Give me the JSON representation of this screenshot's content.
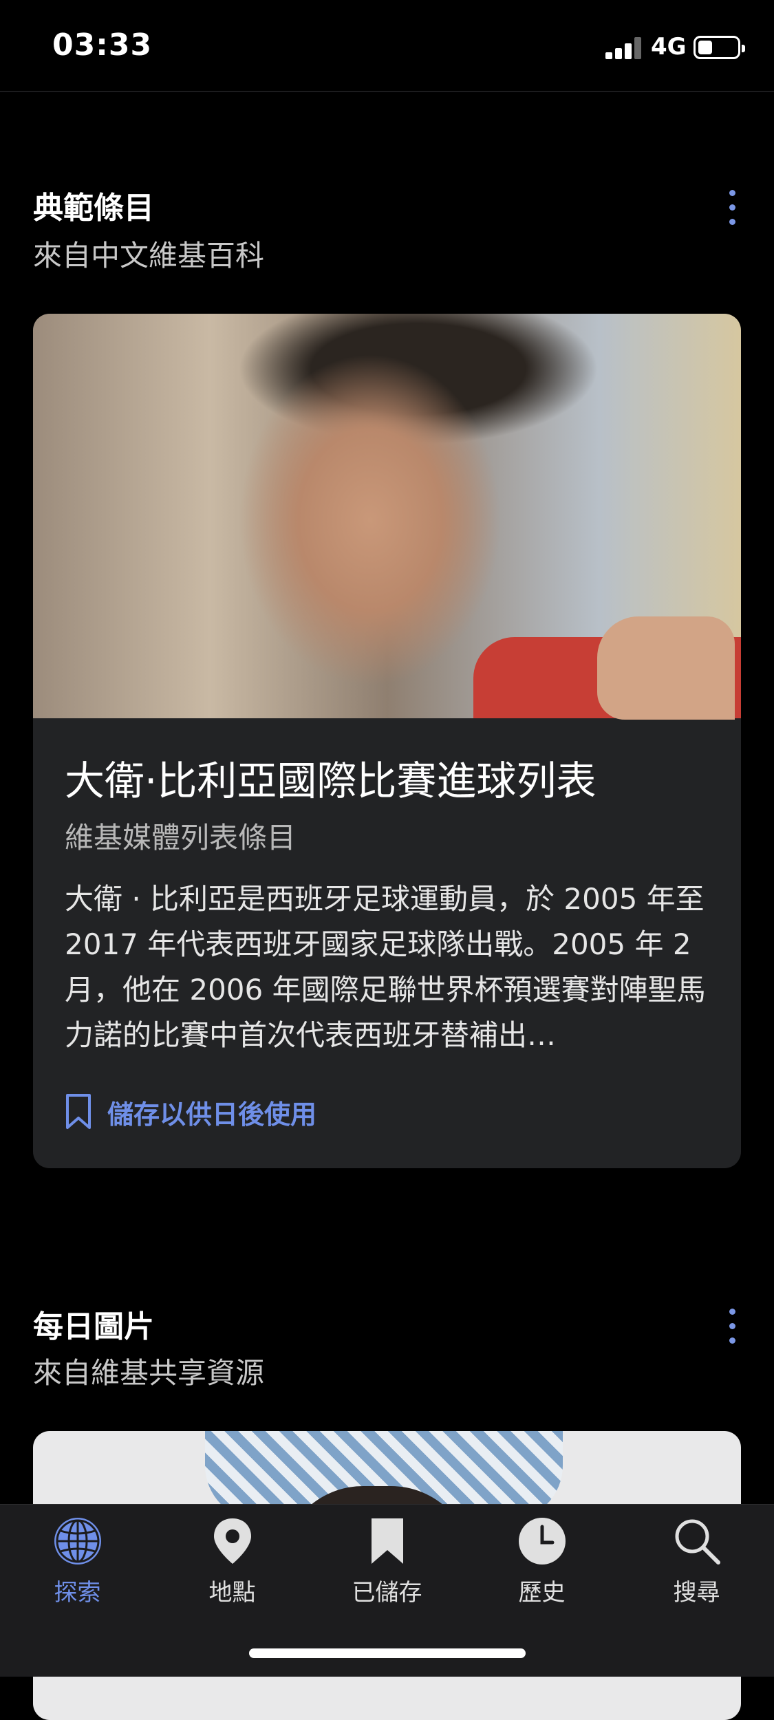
{
  "status_bar": {
    "time": "03:33",
    "network": "4G"
  },
  "featured": {
    "section_title": "典範條目",
    "section_subtitle": "來自中文維基百科",
    "card": {
      "title": "大衛·比利亞國際比賽進球列表",
      "subtitle": "維基媒體列表條目",
      "description": "大衛 · 比利亞是西班牙足球運動員，於 2005 年至 2017 年代表西班牙國家足球隊出戰。2005 年 2 月，他在 2006 年國際足聯世界杯預選賽對陣聖馬力諾的比賽中首次代表西班牙替補出…",
      "save_label": "儲存以供日後使用"
    }
  },
  "picture_of_day": {
    "section_title": "每日圖片",
    "section_subtitle": "來自維基共享資源"
  },
  "tab_bar": {
    "active_color": "#6f8fe8",
    "tabs": [
      {
        "label": "探索",
        "icon": "globe-icon"
      },
      {
        "label": "地點",
        "icon": "location-pin-icon"
      },
      {
        "label": "已儲存",
        "icon": "bookmark-icon"
      },
      {
        "label": "歷史",
        "icon": "clock-icon"
      },
      {
        "label": "搜尋",
        "icon": "search-icon"
      }
    ]
  }
}
